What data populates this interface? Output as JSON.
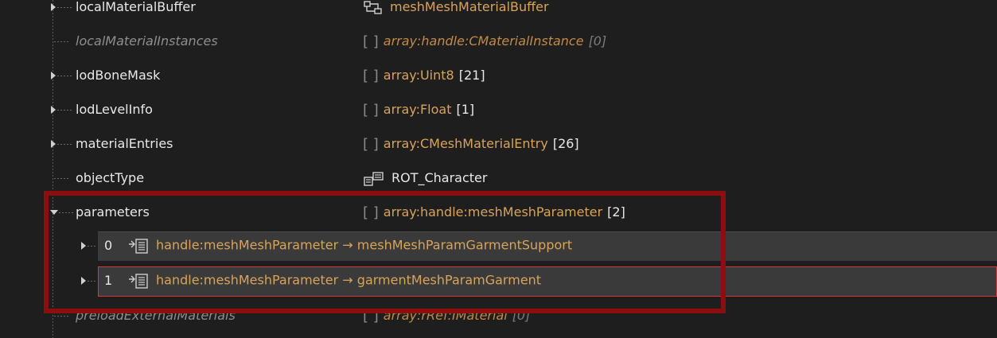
{
  "rows": [
    {
      "name": "localMaterialBuffer",
      "type": "meshMeshMaterialBuffer",
      "kind": "struct"
    },
    {
      "name": "localMaterialInstances",
      "type": "array:handle:CMaterialInstance",
      "count": "[0]",
      "inactive": true
    },
    {
      "name": "lodBoneMask",
      "type": "array:Uint8",
      "count": "[21]"
    },
    {
      "name": "lodLevelInfo",
      "type": "array:Float",
      "count": "[1]"
    },
    {
      "name": "materialEntries",
      "type": "array:CMeshMaterialEntry",
      "count": "[26]"
    },
    {
      "name": "objectType",
      "value": "ROT_Character",
      "kind": "enum"
    },
    {
      "name": "parameters",
      "type": "array:handle:meshMeshParameter",
      "count": "[2]"
    },
    {
      "name": "preloadExternalMaterials",
      "type": "array:rRef:IMaterial",
      "count": "[0]",
      "inactive": true
    }
  ],
  "bracket": "[ ]",
  "children": [
    {
      "index": "0",
      "handle": "handle:meshMeshParameter",
      "arrow": "→",
      "target": "meshMeshParamGarmentSupport"
    },
    {
      "index": "1",
      "handle": "handle:meshMeshParameter",
      "arrow": "→",
      "target": "garmentMeshParamGarment"
    }
  ],
  "icons": {
    "struct": "struct-icon",
    "enum": "enum-icon",
    "handle": "handle-icon"
  },
  "colors": {
    "highlight": "#8c0e0e",
    "type": "#d9a35a",
    "selection": "#d23a3a"
  }
}
